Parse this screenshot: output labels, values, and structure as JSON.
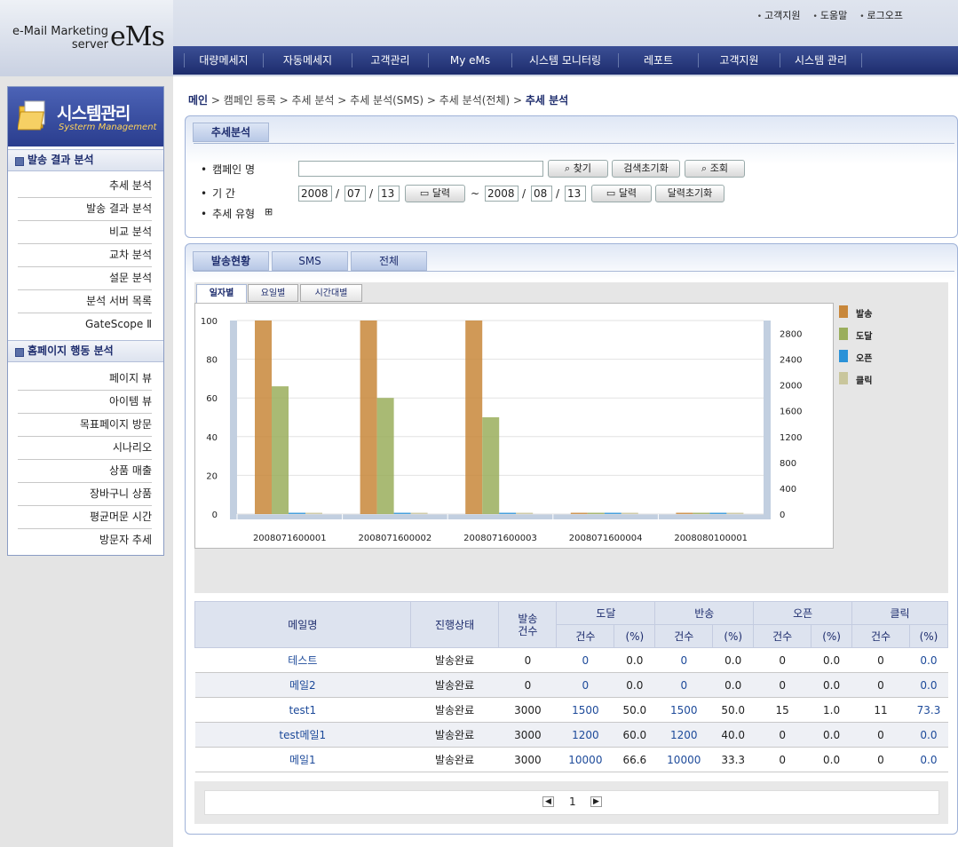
{
  "header": {
    "logo_line1": "e-Mail Marketing",
    "logo_line2": "server",
    "logo_brand": "eMs",
    "top_links": [
      "고객지원",
      "도움말",
      "로그오프"
    ],
    "menu": [
      "대량메세지",
      "자동메세지",
      "고객관리",
      "My eMs",
      "시스템 모니터링",
      "레포트",
      "고객지원",
      "시스템 관리"
    ]
  },
  "sidebar": {
    "banner_title": "시스템관리",
    "banner_sub": "Systerm Management",
    "section1": "발송 결과 분석",
    "section1_items": [
      "추세 분석",
      "발송 결과 분석",
      "비교 분석",
      "교차 분석",
      "설문 분석",
      "분석 서버 목록",
      "GateScope Ⅱ"
    ],
    "section2": "홈페이지 행동 분석",
    "section2_items": [
      "페이지 뷰",
      "아이템 뷰",
      "목표페이지 방문",
      "시나리오",
      "상품 매출",
      "장바구니 상품",
      "평균머문 시간",
      "방문자 추세"
    ]
  },
  "breadcrumb": {
    "path": "> 캠페인 등록 > 추세 분석 > 추세 분석(SMS) > 추세 분석(전체) >",
    "home": "메인",
    "current": "추세 분석"
  },
  "search": {
    "tab": "추세분석",
    "campaign_label": "캠페인 명",
    "campaign_value": "",
    "find_btn": "찾기",
    "reset_btn": "검색초기화",
    "query_btn": "조회",
    "period_label": "기 간",
    "from": {
      "y": "2008",
      "m": "07",
      "d": "13"
    },
    "to": {
      "y": "2008",
      "m": "08",
      "d": "13"
    },
    "cal_btn": "달력",
    "cal_reset_btn": "달력초기화",
    "tilde": "~",
    "type_label": "추세 유형",
    "type_expand": "⊞"
  },
  "result_tabs": [
    "발송현황",
    "SMS",
    "전체"
  ],
  "chart_tabs": [
    "일자별",
    "요일별",
    "시간대별"
  ],
  "chart_data": {
    "type": "bar",
    "categories": [
      "2008071600001",
      "2008071600002",
      "2008071600003",
      "2008071600004",
      "2008080100001"
    ],
    "series": [
      {
        "name": "발송",
        "values": [
          100,
          100,
          100,
          0,
          0
        ],
        "color": "#c8873a"
      },
      {
        "name": "도달",
        "values": [
          66,
          60,
          50,
          0,
          0
        ],
        "color": "#9aae5c"
      },
      {
        "name": "오픈",
        "values": [
          0,
          0,
          0,
          0,
          0
        ],
        "color": "#2a92d8"
      },
      {
        "name": "클릭",
        "values": [
          0,
          0,
          0,
          0,
          0
        ],
        "color": "#c9c69c"
      }
    ],
    "ylim": [
      0,
      100
    ],
    "yticks": [
      0,
      20,
      40,
      60,
      80,
      100
    ],
    "y2lim": [
      0,
      3000
    ],
    "y2ticks": [
      0,
      400,
      800,
      1200,
      1600,
      2000,
      2400,
      2800
    ],
    "legend": "right",
    "grid": true
  },
  "table": {
    "headers": {
      "name": "메일명",
      "status": "진행상태",
      "sent": "발송\n건수",
      "reach": "도달",
      "bounce": "반송",
      "open": "오픈",
      "click": "클릭",
      "count": "건수",
      "pct": "(%)"
    },
    "rows": [
      {
        "name": "테스트",
        "status": "발송완료",
        "sent": "0",
        "reach": "0",
        "reach_pct": "0.0",
        "bounce": "0",
        "bounce_pct": "0.0",
        "open": "0",
        "open_pct": "0.0",
        "click": "0",
        "click_pct": "0.0"
      },
      {
        "name": "메일2",
        "status": "발송완료",
        "sent": "0",
        "reach": "0",
        "reach_pct": "0.0",
        "bounce": "0",
        "bounce_pct": "0.0",
        "open": "0",
        "open_pct": "0.0",
        "click": "0",
        "click_pct": "0.0"
      },
      {
        "name": "test1",
        "status": "발송완료",
        "sent": "3000",
        "reach": "1500",
        "reach_pct": "50.0",
        "bounce": "1500",
        "bounce_pct": "50.0",
        "open": "15",
        "open_pct": "1.0",
        "click": "11",
        "click_pct": "73.3"
      },
      {
        "name": "test메일1",
        "status": "발송완료",
        "sent": "3000",
        "reach": "1200",
        "reach_pct": "60.0",
        "bounce": "1200",
        "bounce_pct": "40.0",
        "open": "0",
        "open_pct": "0.0",
        "click": "0",
        "click_pct": "0.0"
      },
      {
        "name": "메일1",
        "status": "발송완료",
        "sent": "3000",
        "reach": "10000",
        "reach_pct": "66.6",
        "bounce": "10000",
        "bounce_pct": "33.3",
        "open": "0",
        "open_pct": "0.0",
        "click": "0",
        "click_pct": "0.0"
      }
    ]
  },
  "pager": {
    "current": "1",
    "prev": "◀",
    "next": "▶"
  }
}
